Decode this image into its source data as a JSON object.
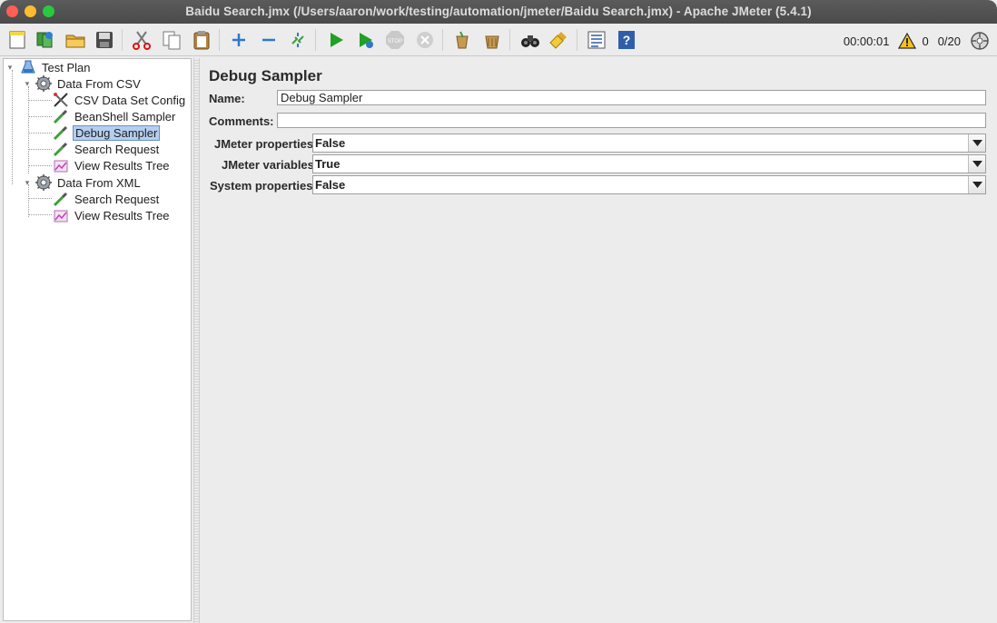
{
  "window": {
    "title": "Baidu Search.jmx (/Users/aaron/work/testing/automation/jmeter/Baidu Search.jmx) - Apache JMeter (5.4.1)"
  },
  "toolbar": {
    "buttons": [
      {
        "name": "new",
        "icon": "new-file-icon"
      },
      {
        "name": "templates",
        "icon": "templates-icon"
      },
      {
        "name": "open",
        "icon": "open-folder-icon"
      },
      {
        "name": "save",
        "icon": "save-icon"
      },
      {
        "name": "cut",
        "icon": "cut-icon"
      },
      {
        "name": "copy",
        "icon": "copy-icon"
      },
      {
        "name": "paste",
        "icon": "paste-icon"
      },
      {
        "name": "expand",
        "icon": "expand-icon"
      },
      {
        "name": "collapse",
        "icon": "collapse-icon"
      },
      {
        "name": "toggle",
        "icon": "toggle-icon"
      },
      {
        "name": "start",
        "icon": "play-icon"
      },
      {
        "name": "start-no-pauses",
        "icon": "play-no-pause-icon"
      },
      {
        "name": "stop",
        "icon": "stop-icon"
      },
      {
        "name": "shutdown",
        "icon": "shutdown-icon"
      },
      {
        "name": "clear",
        "icon": "clear-icon"
      },
      {
        "name": "clear-all",
        "icon": "clear-all-icon"
      },
      {
        "name": "search",
        "icon": "binoculars-icon"
      },
      {
        "name": "reset-search",
        "icon": "broom-icon"
      },
      {
        "name": "function-helper",
        "icon": "function-list-icon"
      },
      {
        "name": "help",
        "icon": "help-icon"
      }
    ]
  },
  "status": {
    "timer": "00:00:01",
    "warnings": "0",
    "threads": "0/20"
  },
  "tree": {
    "test_plan": "Test Plan",
    "group1": "Data From CSV",
    "group1_items": [
      "CSV Data Set Config",
      "BeanShell Sampler",
      "Debug Sampler",
      "Search Request",
      "View Results Tree"
    ],
    "group2": "Data From XML",
    "group2_items": [
      "Search Request",
      "View Results Tree"
    ],
    "selected": "Debug Sampler"
  },
  "panel": {
    "heading": "Debug Sampler",
    "name_label": "Name:",
    "name_value": "Debug Sampler",
    "comments_label": "Comments:",
    "comments_value": "",
    "jmeter_properties_label": "JMeter properties:",
    "jmeter_properties_value": "False",
    "jmeter_variables_label": "JMeter variables:",
    "jmeter_variables_value": "True",
    "system_properties_label": "System properties:",
    "system_properties_value": "False"
  }
}
